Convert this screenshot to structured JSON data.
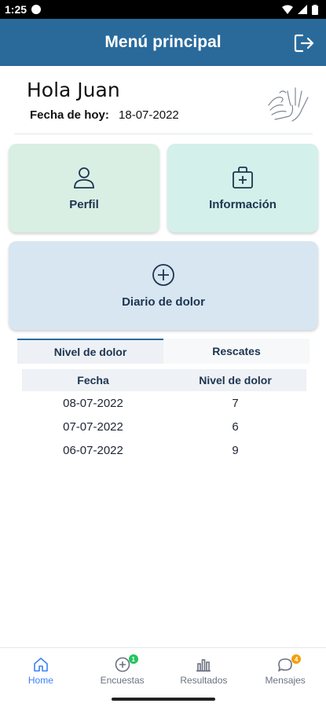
{
  "status_bar": {
    "time": "1:25"
  },
  "app_bar": {
    "title": "Menú principal"
  },
  "greeting": {
    "text": "Hola Juan",
    "date_label": "Fecha de hoy:",
    "date_value": "18-07-2022"
  },
  "tiles": {
    "perfil": {
      "label": "Perfil",
      "icon": "user-icon"
    },
    "informacion": {
      "label": "Información",
      "icon": "medkit-icon"
    },
    "diario": {
      "label": "Diario de dolor",
      "icon": "plus-circle-icon"
    }
  },
  "tabs": [
    {
      "label": "Nivel de dolor",
      "active": true
    },
    {
      "label": "Rescates",
      "active": false
    }
  ],
  "table": {
    "headers": [
      "Fecha",
      "Nivel de dolor"
    ],
    "rows": [
      [
        "08-07-2022",
        "7"
      ],
      [
        "07-07-2022",
        "6"
      ],
      [
        "06-07-2022",
        "9"
      ]
    ]
  },
  "bottom_nav": [
    {
      "label": "Home",
      "icon": "home-icon",
      "active": true
    },
    {
      "label": "Encuestas",
      "icon": "add-circle-icon",
      "badge": "1",
      "badge_color": "#22c55e"
    },
    {
      "label": "Resultados",
      "icon": "bar-chart-icon"
    },
    {
      "label": "Mensajes",
      "icon": "chat-icon",
      "badge": "4",
      "badge_color": "#f59e0b"
    }
  ],
  "colors": {
    "primary": "#2a6a9b",
    "tile_green": "#d9efe4",
    "tile_mint": "#d3f0ea",
    "tile_blue": "#d8e6f2"
  }
}
